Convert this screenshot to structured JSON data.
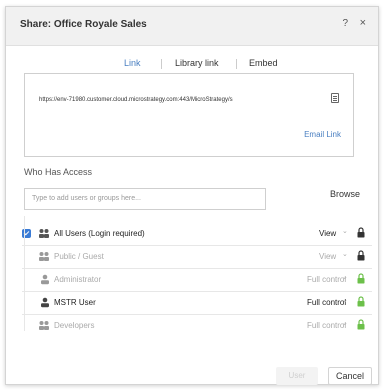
{
  "dialog": {
    "title": "Share: Office Royale Sales",
    "help_label": "?",
    "close_label": "×"
  },
  "tabs": [
    {
      "label": "Link",
      "active": true
    },
    {
      "label": "Library link",
      "active": false
    },
    {
      "label": "Embed",
      "active": false
    }
  ],
  "link_panel": {
    "url": "https://env-71980.customer.cloud.microstrategy.com:443/MicroStrategy/s",
    "email_link_label": "Email Link"
  },
  "access": {
    "heading": "Who Has Access",
    "add_placeholder": "Type to add users or groups here...",
    "browse_label": "Browse",
    "rows": [
      {
        "name": "All Users (Login required)",
        "permission": "View",
        "checked": true,
        "icon": "group-icon",
        "lock": "lock-dark",
        "state": "active"
      },
      {
        "name": "Public / Guest",
        "permission": "View",
        "checked": false,
        "icon": "group-icon",
        "lock": "lock-dark",
        "state": "muted"
      },
      {
        "name": "Administrator",
        "permission": "Full control",
        "checked": false,
        "icon": "user-icon",
        "lock": "lock-green",
        "state": "muted"
      },
      {
        "name": "MSTR User",
        "permission": "Full control",
        "checked": false,
        "icon": "user-icon",
        "lock": "lock-green",
        "state": "active"
      },
      {
        "name": "Developers",
        "permission": "Full control",
        "checked": false,
        "icon": "group-icon",
        "lock": "lock-green",
        "state": "muted"
      }
    ]
  },
  "footer": {
    "apply_label": "User",
    "cancel_label": "Cancel"
  },
  "colors": {
    "accent": "#4a7fc1",
    "checkbox": "#3a7bd5",
    "lock_dark": "#333333",
    "lock_green": "#6cc04a"
  }
}
